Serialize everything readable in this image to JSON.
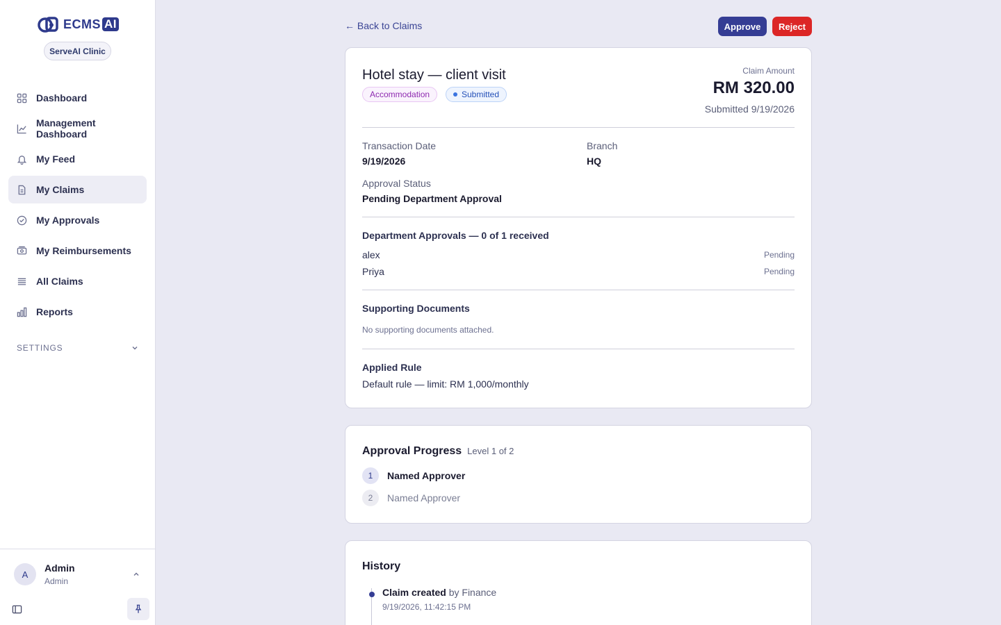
{
  "brand": {
    "name": "ECMS",
    "suffix": "AI",
    "clinic": "ServeAI Clinic"
  },
  "nav": [
    {
      "label": "Dashboard",
      "icon": "grid-icon",
      "active": false
    },
    {
      "label": "Management Dashboard",
      "icon": "line-chart-icon",
      "active": false
    },
    {
      "label": "My Feed",
      "icon": "bell-icon",
      "active": false
    },
    {
      "label": "My Claims",
      "icon": "document-icon",
      "active": true
    },
    {
      "label": "My Approvals",
      "icon": "check-circle-icon",
      "active": false
    },
    {
      "label": "My Reimbursements",
      "icon": "wallet-icon",
      "active": false
    },
    {
      "label": "All Claims",
      "icon": "list-icon",
      "active": false
    },
    {
      "label": "Reports",
      "icon": "bar-chart-icon",
      "active": false
    }
  ],
  "settings": {
    "label": "SETTINGS"
  },
  "user": {
    "initial": "A",
    "name": "Admin",
    "role": "Admin"
  },
  "header": {
    "back_label": "← Back to Claims",
    "approve_label": "Approve",
    "reject_label": "Reject"
  },
  "claim": {
    "title": "Hotel stay — client visit",
    "category": "Accommodation",
    "status": "Submitted",
    "amount_label": "Claim Amount",
    "amount": "RM 320.00",
    "submitted": "Submitted 9/19/2026",
    "fields": {
      "transaction_date_label": "Transaction Date",
      "transaction_date": "9/19/2026",
      "branch_label": "Branch",
      "branch": "HQ",
      "approval_status_label": "Approval Status",
      "approval_status": "Pending Department Approval"
    },
    "department_approvals": {
      "title": "Department Approvals — 0 of 1 received",
      "approvers": [
        {
          "name": "alex",
          "status": "Pending"
        },
        {
          "name": "Priya",
          "status": "Pending"
        }
      ]
    },
    "documents": {
      "title": "Supporting Documents",
      "empty": "No supporting documents attached."
    },
    "rule": {
      "title": "Applied Rule",
      "text": "Default rule — limit: RM 1,000/monthly"
    }
  },
  "progress": {
    "title": "Approval Progress",
    "level": "Level 1 of 2",
    "steps": [
      {
        "num": "1",
        "label": "Named Approver",
        "state": "current"
      },
      {
        "num": "2",
        "label": "Named Approver",
        "state": "future"
      }
    ]
  },
  "history": {
    "title": "History",
    "events": [
      {
        "action": "Claim created",
        "by": "by Finance",
        "time": "9/19/2026, 11:42:15 PM"
      }
    ]
  },
  "colors": {
    "accent": "#353d94",
    "danger": "#dc2626",
    "background": "#e9e9f3"
  }
}
